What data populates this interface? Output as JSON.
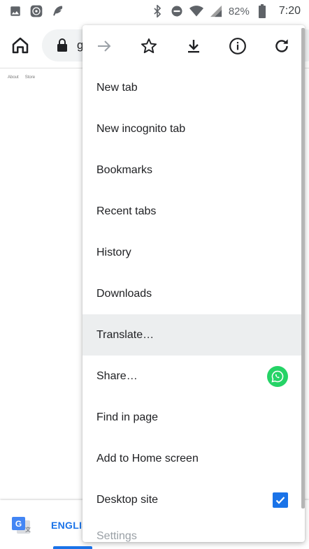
{
  "status_bar": {
    "battery": "82%",
    "time": "7:20",
    "icons_left": [
      "image-icon",
      "camera-circle-icon",
      "feather-icon"
    ],
    "icons_right": [
      "bluetooth-icon",
      "do-not-disturb-icon",
      "wifi-icon",
      "signal-icon",
      "battery-icon"
    ]
  },
  "toolbar": {
    "url_text": "g"
  },
  "page": {
    "links": [
      "About",
      "Store"
    ]
  },
  "menu": {
    "top_icons": [
      "forward-icon",
      "star-icon",
      "download-icon",
      "info-icon",
      "refresh-icon"
    ],
    "items": [
      {
        "label": "New tab"
      },
      {
        "label": "New incognito tab"
      },
      {
        "label": "Bookmarks"
      },
      {
        "label": "Recent tabs"
      },
      {
        "label": "History"
      },
      {
        "label": "Downloads"
      },
      {
        "label": "Translate…"
      },
      {
        "label": "Share…"
      },
      {
        "label": "Find in page"
      },
      {
        "label": "Add to Home screen"
      },
      {
        "label": "Desktop site"
      },
      {
        "label": "Settings"
      }
    ],
    "desktop_site_checked": true
  },
  "translate_bar": {
    "language_tab": "ENGLIS"
  },
  "colors": {
    "accent": "#1a73e8",
    "whatsapp": "#25d366",
    "highlight": "#eceeef"
  }
}
